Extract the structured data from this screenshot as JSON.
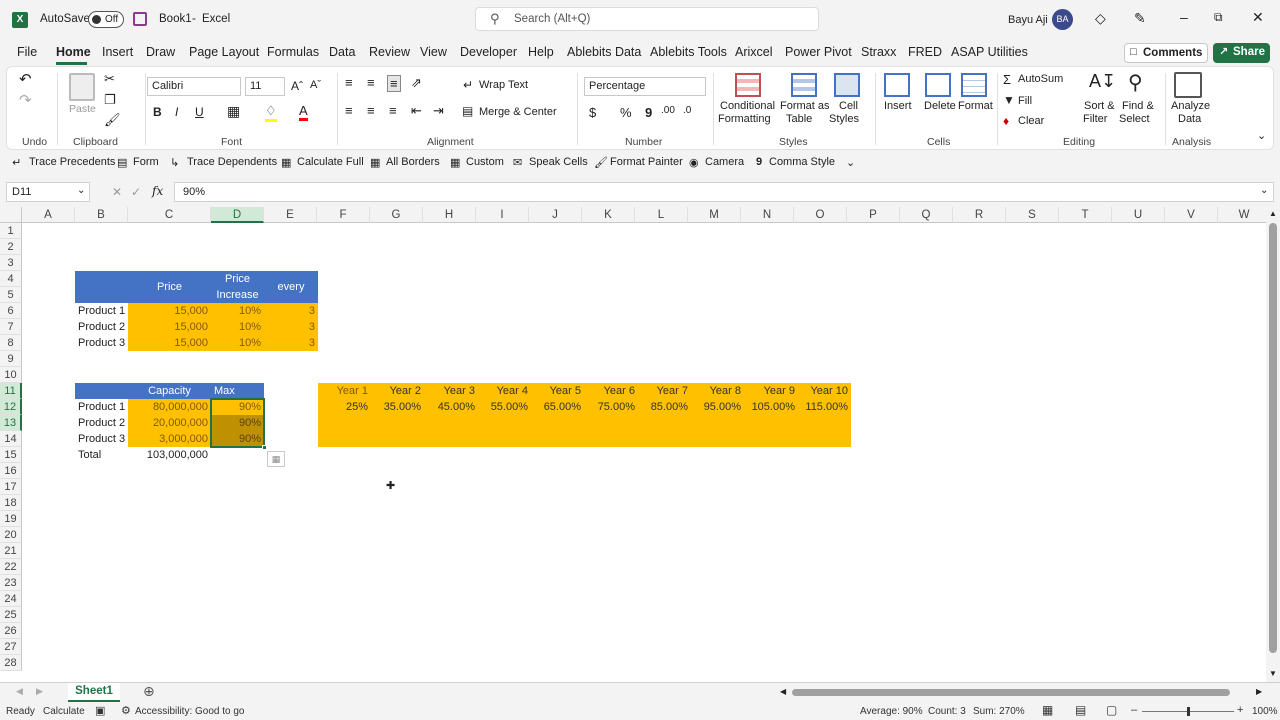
{
  "title": {
    "autosave_label": "AutoSave",
    "autosave_state": "Off",
    "filename": "Book1",
    "separator": "-",
    "app": "Excel",
    "search_placeholder": "Search (Alt+Q)",
    "user": "Bayu Aji",
    "initials": "BA"
  },
  "tabs": [
    "File",
    "Home",
    "Insert",
    "Draw",
    "Page Layout",
    "Formulas",
    "Data",
    "Review",
    "View",
    "Developer",
    "Help",
    "Ablebits Data",
    "Ablebits Tools",
    "Arixcel",
    "Power Pivot",
    "Straxx",
    "FRED",
    "ASAP Utilities"
  ],
  "actions": {
    "comments": "Comments",
    "share": "Share"
  },
  "ribbon": {
    "undo": "Undo",
    "clipboard": "Clipboard",
    "paste": "Paste",
    "font_group": "Font",
    "font_name": "Calibri",
    "font_size": "11",
    "alignment": "Alignment",
    "wrap_text": "Wrap Text",
    "merge_center": "Merge & Center",
    "number": "Number",
    "number_format": "Percentage",
    "styles": "Styles",
    "conditional_formatting": [
      "Conditional",
      "Formatting"
    ],
    "format_as_table": [
      "Format as",
      "Table"
    ],
    "cell_styles": [
      "Cell",
      "Styles"
    ],
    "cells": "Cells",
    "insert": "Insert",
    "delete": "Delete",
    "format": "Format",
    "editing": "Editing",
    "autosum": "AutoSum",
    "fill": "Fill",
    "clear": "Clear",
    "sort_filter": [
      "Sort &",
      "Filter"
    ],
    "find_select": [
      "Find &",
      "Select"
    ],
    "analysis": "Analysis",
    "analyze_data": [
      "Analyze",
      "Data"
    ]
  },
  "qat": [
    "Trace Precedents",
    "Form",
    "Trace Dependents",
    "Calculate Full",
    "All Borders",
    "Custom",
    "Speak Cells",
    "Format Painter",
    "Camera",
    "Comma Style"
  ],
  "formula_bar": {
    "name_box": "D11",
    "fx": "fx",
    "value": "90%"
  },
  "columns": [
    "A",
    "B",
    "C",
    "D",
    "E",
    "F",
    "G",
    "H",
    "I",
    "J",
    "K",
    "L",
    "M",
    "N",
    "O",
    "P",
    "Q",
    "R",
    "S",
    "T",
    "U",
    "V",
    "W"
  ],
  "rows": [
    "1",
    "2",
    "3",
    "4",
    "5",
    "6",
    "7",
    "8",
    "9",
    "10",
    "11",
    "12",
    "13",
    "14",
    "15",
    "16",
    "17",
    "18",
    "19",
    "20",
    "21",
    "22",
    "23",
    "24",
    "25",
    "26",
    "27",
    "28"
  ],
  "table1": {
    "headers": [
      "Price",
      "Price",
      "Increase",
      "every"
    ],
    "rows": [
      [
        "Product 1",
        "15,000",
        "10%",
        "3"
      ],
      [
        "Product 2",
        "15,000",
        "10%",
        "3"
      ],
      [
        "Product 3",
        "15,000",
        "10%",
        "3"
      ]
    ]
  },
  "table2": {
    "headers": [
      "Capacity",
      "Max"
    ],
    "rows": [
      [
        "Product 1",
        "80,000,000",
        "90%"
      ],
      [
        "Product 2",
        "20,000,000",
        "90%"
      ],
      [
        "Product 3",
        "3,000,000",
        "90%"
      ]
    ],
    "total_label": "Total",
    "total_value": "103,000,000"
  },
  "years": {
    "labels": [
      "Year 1",
      "Year 2",
      "Year 3",
      "Year 4",
      "Year 5",
      "Year 6",
      "Year 7",
      "Year 8",
      "Year 9",
      "Year 10"
    ],
    "values": [
      "25%",
      "35.00%",
      "45.00%",
      "55.00%",
      "65.00%",
      "75.00%",
      "85.00%",
      "95.00%",
      "105.00%",
      "115.00%"
    ]
  },
  "sheet": {
    "name": "Sheet1"
  },
  "status": {
    "ready": "Ready",
    "calculate": "Calculate",
    "accessibility": "Accessibility: Good to go",
    "average": "Average: 90%",
    "count": "Count: 3",
    "sum": "Sum: 270%",
    "zoom": "100%"
  },
  "colors": {
    "excel_green": "#217346",
    "header_blue": "#4472c4",
    "gold": "#ffc000",
    "dark_gold": "#bf9000"
  }
}
